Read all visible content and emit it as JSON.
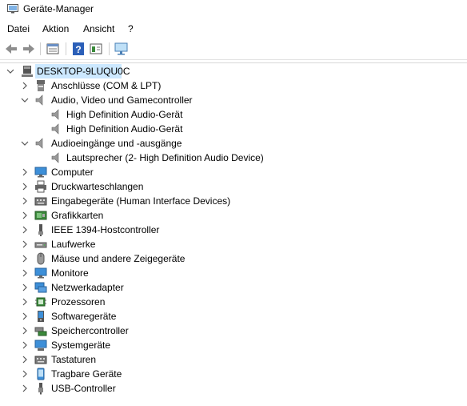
{
  "window": {
    "title": "Geräte-Manager"
  },
  "menu": [
    "Datei",
    "Aktion",
    "Ansicht",
    "?"
  ],
  "toolbar": {
    "buttons": [
      "back-icon",
      "forward-icon",
      "properties-icon",
      "help-icon",
      "view-icon",
      "monitor-scan-icon"
    ]
  },
  "tree": {
    "root": "DESKTOP-9LUQU0C",
    "items": [
      {
        "label": "Anschlüsse (COM & LPT)",
        "icon": "port-icon",
        "expanded": false
      },
      {
        "label": "Audio, Video und Gamecontroller",
        "icon": "speaker-icon",
        "expanded": true,
        "children": [
          "High Definition Audio-Gerät",
          "High Definition Audio-Gerät"
        ]
      },
      {
        "label": "Audioeingänge und -ausgänge",
        "icon": "speaker-icon",
        "expanded": true,
        "children": [
          "Lautsprecher (2- High Definition Audio Device)"
        ]
      },
      {
        "label": "Computer",
        "icon": "computer-icon",
        "expanded": false
      },
      {
        "label": "Druckwarteschlangen",
        "icon": "printer-icon",
        "expanded": false
      },
      {
        "label": "Eingabegeräte (Human Interface Devices)",
        "icon": "keyboard-icon",
        "expanded": false
      },
      {
        "label": "Grafikkarten",
        "icon": "display-adapter-icon",
        "expanded": false
      },
      {
        "label": "IEEE 1394-Hostcontroller",
        "icon": "firewire-icon",
        "expanded": false
      },
      {
        "label": "Laufwerke",
        "icon": "drive-icon",
        "expanded": false
      },
      {
        "label": "Mäuse und andere Zeigegeräte",
        "icon": "mouse-icon",
        "expanded": false
      },
      {
        "label": "Monitore",
        "icon": "monitor-icon",
        "expanded": false
      },
      {
        "label": "Netzwerkadapter",
        "icon": "network-icon",
        "expanded": false
      },
      {
        "label": "Prozessoren",
        "icon": "processor-icon",
        "expanded": false
      },
      {
        "label": "Softwaregeräte",
        "icon": "software-device-icon",
        "expanded": false
      },
      {
        "label": "Speichercontroller",
        "icon": "storage-controller-icon",
        "expanded": false
      },
      {
        "label": "Systemgeräte",
        "icon": "system-device-icon",
        "expanded": false
      },
      {
        "label": "Tastaturen",
        "icon": "keyboard-icon",
        "expanded": false
      },
      {
        "label": "Tragbare Geräte",
        "icon": "portable-device-icon",
        "expanded": false
      },
      {
        "label": "USB-Controller",
        "icon": "usb-icon",
        "expanded": false
      }
    ]
  },
  "colors": {
    "selection": "#cce8ff",
    "accent": "#0078d7"
  }
}
